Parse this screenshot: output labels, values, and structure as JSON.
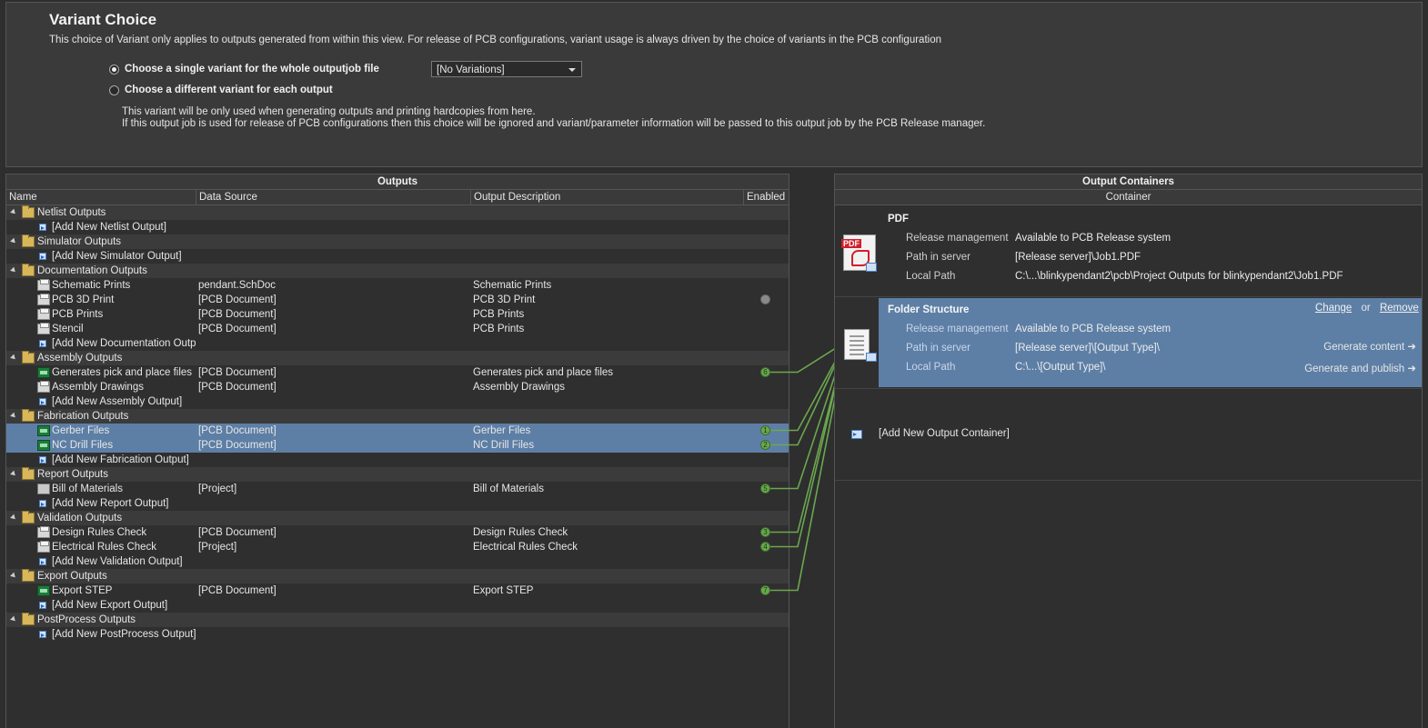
{
  "variant": {
    "title": "Variant Choice",
    "description": "This choice of Variant only applies to outputs generated from within this view. For release of PCB configurations, variant usage is always driven by the choice of variants in the PCB configuration",
    "option_single": "Choose a single variant for the whole outputjob file",
    "option_each": "Choose a different variant for each output",
    "selected_option": "single",
    "select_value": "[No Variations]",
    "note_line1": "This variant will be only used when generating outputs and printing hardcopies from here.",
    "note_line2": "If this output job is used for release of PCB configurations then this choice will be ignored and variant/parameter information will be passed to this output job by the PCB Release manager."
  },
  "outputs": {
    "title": "Outputs",
    "columns": {
      "name": "Name",
      "source": "Data Source",
      "desc": "Output Description",
      "enabled": "Enabled"
    },
    "rows": [
      {
        "type": "group",
        "name": "Netlist Outputs"
      },
      {
        "type": "add",
        "name": "[Add New Netlist Output]"
      },
      {
        "type": "group",
        "name": "Simulator Outputs"
      },
      {
        "type": "add",
        "name": "[Add New Simulator Output]"
      },
      {
        "type": "group",
        "name": "Documentation Outputs"
      },
      {
        "type": "item",
        "icon": "printer",
        "name": "Schematic Prints",
        "source": "pendant.SchDoc",
        "desc": "Schematic Prints",
        "badge": ""
      },
      {
        "type": "item",
        "icon": "printer",
        "name": "PCB 3D Print",
        "source": "[PCB Document]",
        "desc": "PCB 3D Print",
        "badge": "gray"
      },
      {
        "type": "item",
        "icon": "printer",
        "name": "PCB Prints",
        "source": "[PCB Document]",
        "desc": "PCB Prints",
        "badge": ""
      },
      {
        "type": "item",
        "icon": "printer",
        "name": "Stencil",
        "source": "[PCB Document]",
        "desc": "PCB Prints",
        "badge": ""
      },
      {
        "type": "add",
        "name": "[Add New Documentation Outp"
      },
      {
        "type": "group",
        "name": "Assembly Outputs"
      },
      {
        "type": "item",
        "icon": "chip",
        "name": "Generates pick and place files",
        "source": "[PCB Document]",
        "desc": "Generates pick and place files",
        "badge": "6"
      },
      {
        "type": "item",
        "icon": "printer",
        "name": "Assembly Drawings",
        "source": "[PCB Document]",
        "desc": "Assembly Drawings",
        "badge": ""
      },
      {
        "type": "add",
        "name": "[Add New Assembly Output]"
      },
      {
        "type": "group",
        "name": "Fabrication Outputs"
      },
      {
        "type": "item",
        "icon": "chip",
        "name": "Gerber Files",
        "source": "[PCB Document]",
        "desc": "Gerber Files",
        "badge": "1",
        "selected": true
      },
      {
        "type": "item",
        "icon": "chip",
        "name": "NC Drill Files",
        "source": "[PCB Document]",
        "desc": "NC Drill Files",
        "badge": "2",
        "selected": true
      },
      {
        "type": "add",
        "name": "[Add New Fabrication Output]"
      },
      {
        "type": "group",
        "name": "Report Outputs"
      },
      {
        "type": "item",
        "icon": "bom",
        "name": "Bill of Materials",
        "source": "[Project]",
        "desc": "Bill of Materials",
        "badge": "5"
      },
      {
        "type": "add",
        "name": "[Add New Report Output]"
      },
      {
        "type": "group",
        "name": "Validation Outputs"
      },
      {
        "type": "item",
        "icon": "printer",
        "name": "Design Rules Check",
        "source": "[PCB Document]",
        "desc": "Design Rules Check",
        "badge": "3"
      },
      {
        "type": "item",
        "icon": "printer",
        "name": "Electrical Rules Check",
        "source": "[Project]",
        "desc": "Electrical Rules Check",
        "badge": "4"
      },
      {
        "type": "add",
        "name": "[Add New Validation Output]"
      },
      {
        "type": "group",
        "name": "Export Outputs"
      },
      {
        "type": "item",
        "icon": "chip",
        "name": "Export STEP",
        "source": "[PCB Document]",
        "desc": "Export STEP",
        "badge": "7"
      },
      {
        "type": "add",
        "name": "[Add New Export Output]"
      },
      {
        "type": "group",
        "name": "PostProcess Outputs"
      },
      {
        "type": "add",
        "name": "[Add New PostProcess Output]"
      }
    ]
  },
  "containers": {
    "title": "Output Containers",
    "column": "Container",
    "pdf": {
      "name": "PDF",
      "icon_label": "PDF",
      "release_label": "Release management",
      "release_value": "Available to PCB Release system",
      "server_label": "Path in server",
      "server_value": "[Release server]\\Job1.PDF",
      "local_label": "Local Path",
      "local_value": "C:\\...\\blinkypendant2\\pcb\\Project Outputs for blinkypendant2\\Job1.PDF"
    },
    "folder": {
      "name": "Folder Structure",
      "change": "Change",
      "or": "or",
      "remove": "Remove",
      "release_label": "Release management",
      "release_value": "Available to PCB Release system",
      "server_label": "Path in server",
      "server_value": "[Release server]\\[Output Type]\\",
      "local_label": "Local Path",
      "local_value": "C:\\...\\[Output Type]\\",
      "generate_content": "Generate content",
      "generate_publish": "Generate and publish"
    },
    "add_new": "[Add New Output Container]"
  },
  "colors": {
    "background": "#2e2e2e",
    "selection": "#5d7fa6",
    "link_lines": "#6aa84f"
  }
}
